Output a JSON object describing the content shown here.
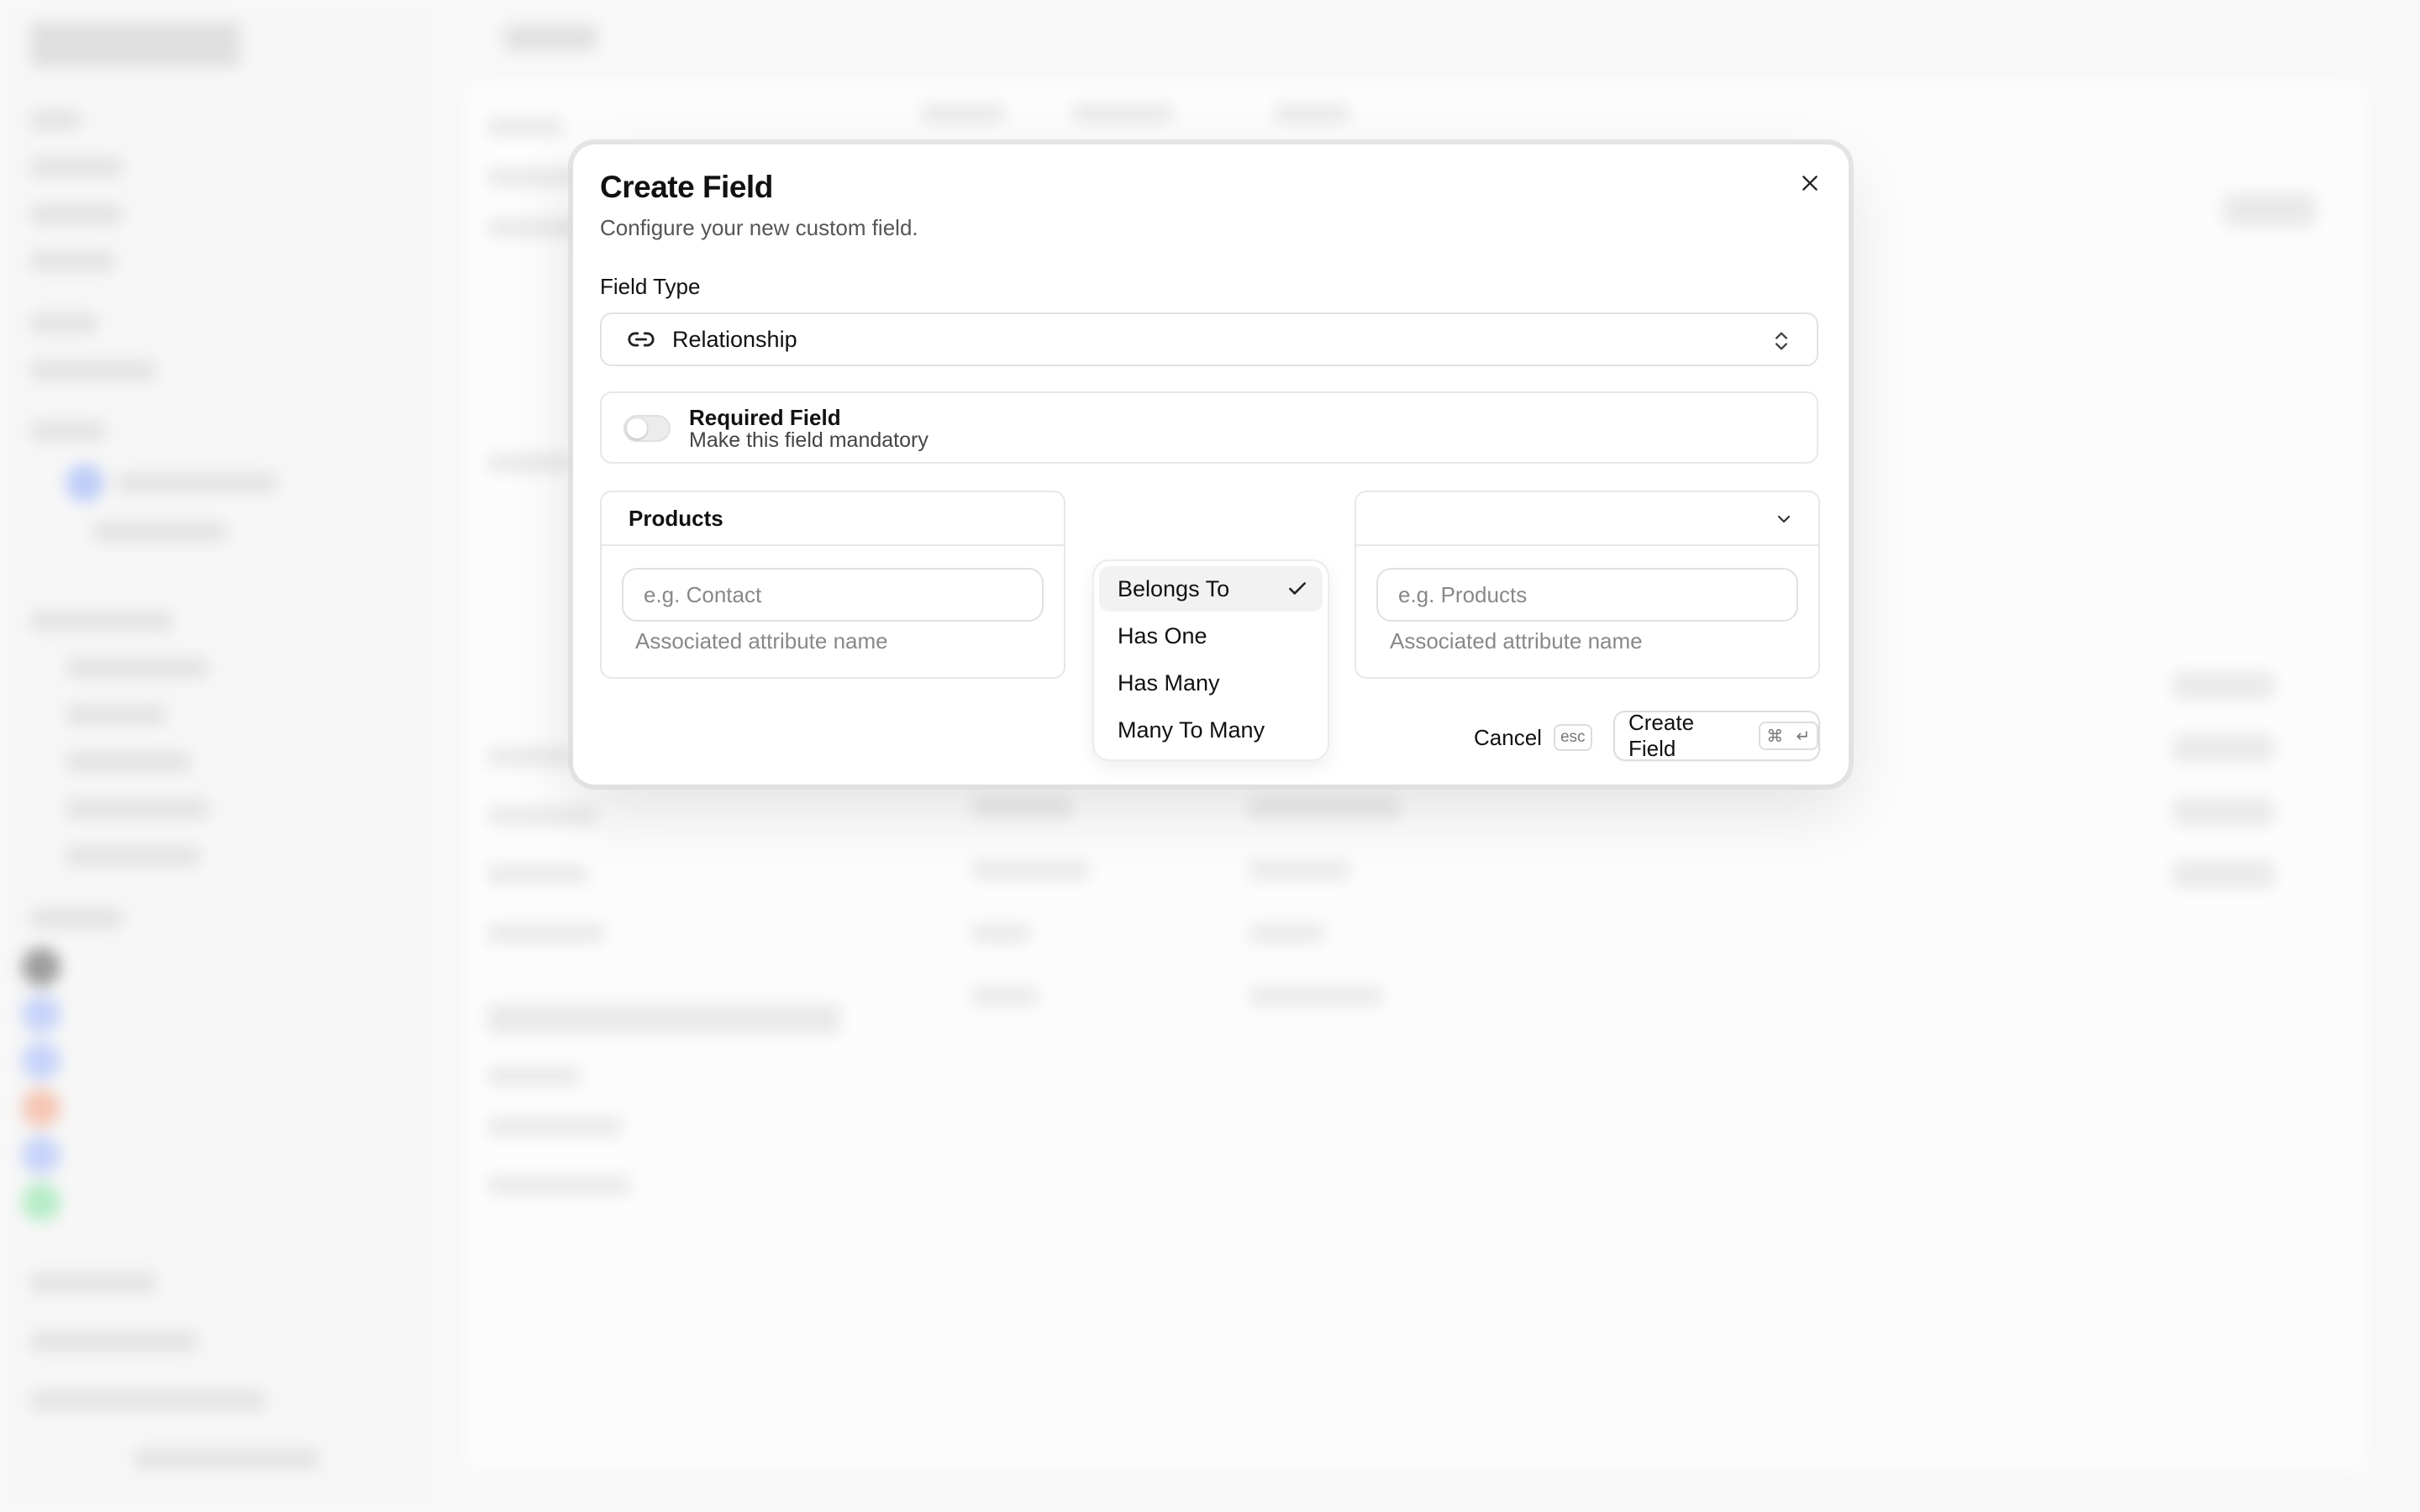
{
  "dialog": {
    "title": "Create Field",
    "subtitle": "Configure your new custom field.",
    "field_type_label": "Field Type",
    "field_type_value": "Relationship",
    "required": {
      "title": "Required Field",
      "description": "Make this field mandatory",
      "enabled": false
    },
    "source_panel": {
      "entity": "Products",
      "input_placeholder": "e.g. Contact",
      "input_value": "",
      "help": "Associated attribute name"
    },
    "target_panel": {
      "entity": "",
      "input_placeholder": "e.g. Products",
      "input_value": "",
      "help": "Associated attribute name"
    },
    "relationship_options": [
      {
        "label": "Belongs To",
        "selected": true
      },
      {
        "label": "Has One",
        "selected": false
      },
      {
        "label": "Has Many",
        "selected": false
      },
      {
        "label": "Many To Many",
        "selected": false
      }
    ],
    "cancel": {
      "label": "Cancel",
      "shortcut": "esc"
    },
    "create": {
      "label": "Create Field",
      "shortcut_keys": [
        "⌘",
        "↵"
      ]
    }
  },
  "icons": {
    "close": "close-icon",
    "field_type": "link-icon",
    "select": "chevrons-up-down-icon",
    "target_select": "chevron-down-icon",
    "option_selected": "check-icon"
  },
  "colors": {
    "text": "#111111",
    "muted": "#888888",
    "border": "#e2e2e2",
    "selected_bg": "#f2f2f2"
  }
}
